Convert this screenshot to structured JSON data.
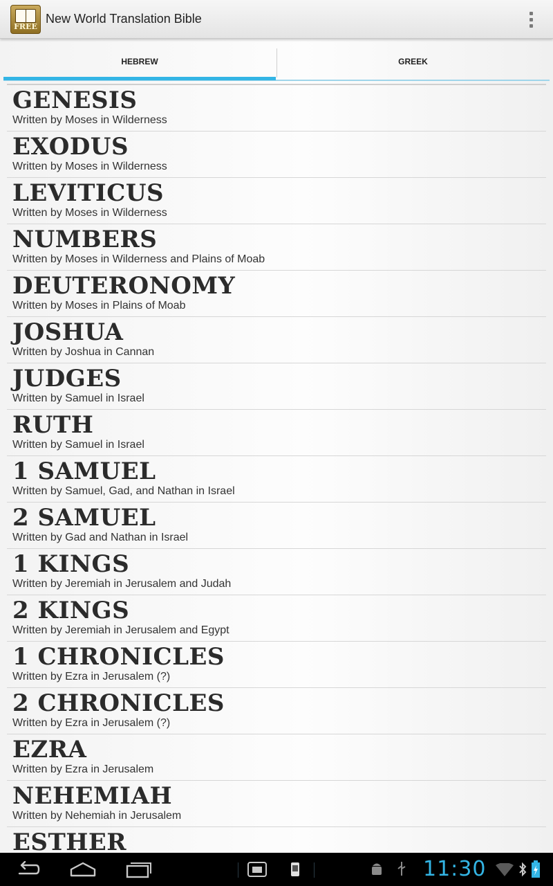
{
  "app": {
    "title": "New World Translation Bible",
    "icon_badge": "FREE",
    "overflow_icon": "overflow-menu-icon"
  },
  "tabs": [
    {
      "label": "HEBREW",
      "selected": true
    },
    {
      "label": "GREEK",
      "selected": false
    }
  ],
  "accent_color": "#33b5e5",
  "books": [
    {
      "name": "GENESIS",
      "subtitle": "Written by Moses in Wilderness"
    },
    {
      "name": "EXODUS",
      "subtitle": "Written by Moses in Wilderness"
    },
    {
      "name": "LEVITICUS",
      "subtitle": "Written by Moses in Wilderness"
    },
    {
      "name": "NUMBERS",
      "subtitle": "Written by Moses in Wilderness and Plains of Moab"
    },
    {
      "name": "DEUTERONOMY",
      "subtitle": "Written by Moses in Plains of Moab"
    },
    {
      "name": "JOSHUA",
      "subtitle": "Written by Joshua in Cannan"
    },
    {
      "name": "JUDGES",
      "subtitle": "Written by Samuel in Israel"
    },
    {
      "name": "RUTH",
      "subtitle": "Written by Samuel in Israel"
    },
    {
      "name": "1 SAMUEL",
      "subtitle": "Written by Samuel, Gad, and Nathan in Israel"
    },
    {
      "name": "2 SAMUEL",
      "subtitle": "Written by Gad and Nathan in Israel"
    },
    {
      "name": "1 KINGS",
      "subtitle": "Written by Jeremiah in Jerusalem and Judah"
    },
    {
      "name": "2 KINGS",
      "subtitle": "Written by Jeremiah in Jerusalem and Egypt"
    },
    {
      "name": "1 CHRONICLES",
      "subtitle": "Written by Ezra in Jerusalem (?)"
    },
    {
      "name": "2 CHRONICLES",
      "subtitle": "Written by Ezra in Jerusalem (?)"
    },
    {
      "name": "EZRA",
      "subtitle": "Written by Ezra in Jerusalem"
    },
    {
      "name": "NEHEMIAH",
      "subtitle": "Written by Nehemiah in Jerusalem"
    },
    {
      "name": "ESTHER",
      "subtitle": ""
    }
  ],
  "system_bar": {
    "time": "11:30",
    "icons": [
      "back-icon",
      "home-icon",
      "recent-apps-icon",
      "screenshot-icon",
      "sd-card-icon",
      "android-debug-icon",
      "usb-icon",
      "wifi-icon",
      "bluetooth-icon",
      "battery-charging-icon"
    ]
  }
}
